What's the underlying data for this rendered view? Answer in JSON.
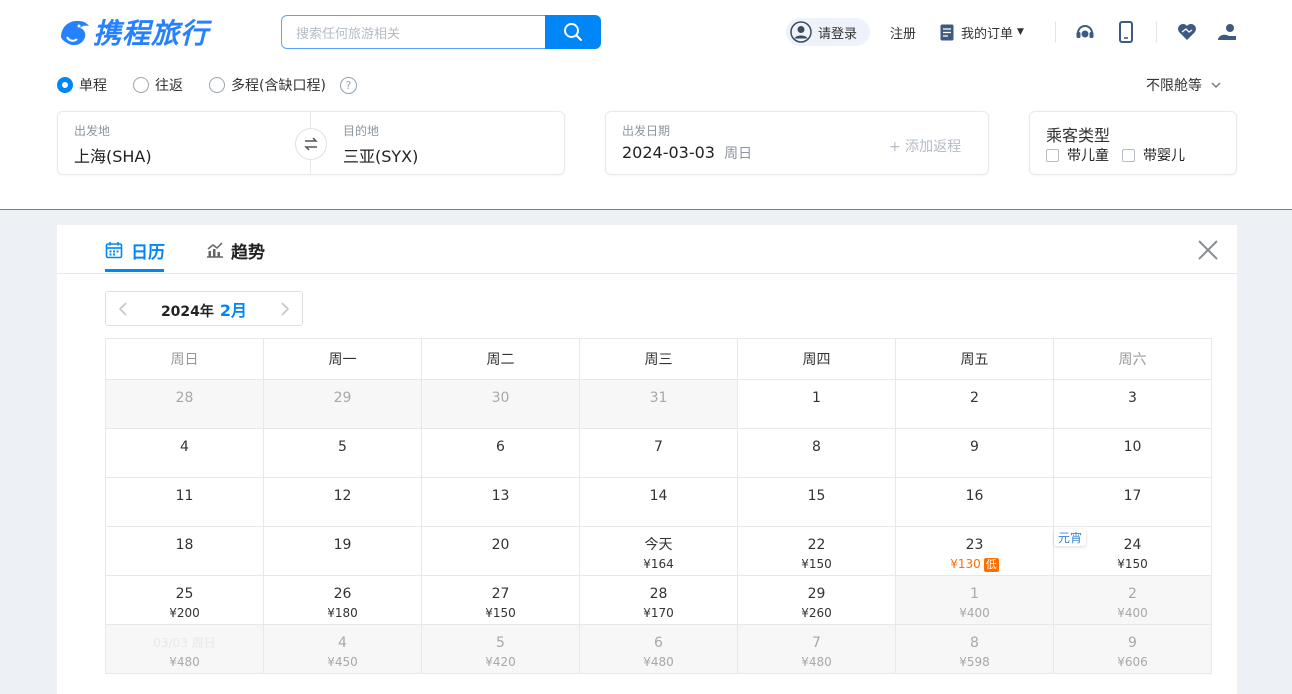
{
  "brand": {
    "name": "携程旅行",
    "color": "#0086f6"
  },
  "search": {
    "placeholder": "搜索任何旅游相关"
  },
  "header": {
    "login": "请登录",
    "register": "注册",
    "orders": "我的订单",
    "icons": [
      "customer-service-icon",
      "mobile-icon",
      "favorites-icon",
      "user-service-icon"
    ]
  },
  "trip_type": {
    "options": [
      "单程",
      "往返",
      "多程(含缺口程)"
    ],
    "selected": "单程",
    "cabin": "不限舱等"
  },
  "route": {
    "from_label": "出发地",
    "from_value": "上海(SHA)",
    "to_label": "目的地",
    "to_value": "三亚(SYX)"
  },
  "date": {
    "label": "出发日期",
    "value": "2024-03-03",
    "weekday": "周日",
    "add_return": "+ 添加返程"
  },
  "passengers": {
    "label": "乘客类型",
    "child": "带儿童",
    "infant": "带婴儿"
  },
  "calendar_panel": {
    "tabs": [
      "日历",
      "趋势"
    ],
    "year": "2024年",
    "month": "2月",
    "weekdays": [
      "周日",
      "周一",
      "周二",
      "周三",
      "周四",
      "周五",
      "周六"
    ],
    "weeks": [
      [
        {
          "n": "28",
          "dim": true
        },
        {
          "n": "29",
          "dim": true
        },
        {
          "n": "30",
          "dim": true
        },
        {
          "n": "31",
          "dim": true
        },
        {
          "n": "1"
        },
        {
          "n": "2"
        },
        {
          "n": "3"
        }
      ],
      [
        {
          "n": "4"
        },
        {
          "n": "5"
        },
        {
          "n": "6"
        },
        {
          "n": "7"
        },
        {
          "n": "8"
        },
        {
          "n": "9"
        },
        {
          "n": "10"
        }
      ],
      [
        {
          "n": "11"
        },
        {
          "n": "12"
        },
        {
          "n": "13"
        },
        {
          "n": "14"
        },
        {
          "n": "15"
        },
        {
          "n": "16"
        },
        {
          "n": "17"
        }
      ],
      [
        {
          "n": "18"
        },
        {
          "n": "19"
        },
        {
          "n": "20"
        },
        {
          "n": "今天",
          "p": "¥164"
        },
        {
          "n": "22",
          "p": "¥150"
        },
        {
          "n": "23",
          "p": "¥130",
          "low": true,
          "badge": "低"
        },
        {
          "n": "24",
          "p": "¥150",
          "holiday": "元宵"
        }
      ],
      [
        {
          "n": "25",
          "p": "¥200"
        },
        {
          "n": "26",
          "p": "¥180"
        },
        {
          "n": "27",
          "p": "¥150"
        },
        {
          "n": "28",
          "p": "¥170"
        },
        {
          "n": "29",
          "p": "¥260"
        },
        {
          "n": "1",
          "p": "¥400",
          "dim": true
        },
        {
          "n": "2",
          "p": "¥400",
          "dim": true
        }
      ],
      [
        {
          "n": "03/03 周日",
          "p": "¥480",
          "dim": true,
          "faint": true
        },
        {
          "n": "4",
          "p": "¥450",
          "dim": true
        },
        {
          "n": "5",
          "p": "¥420",
          "dim": true
        },
        {
          "n": "6",
          "p": "¥480",
          "dim": true
        },
        {
          "n": "7",
          "p": "¥480",
          "dim": true
        },
        {
          "n": "8",
          "p": "¥598",
          "dim": true
        },
        {
          "n": "9",
          "p": "¥606",
          "dim": true
        }
      ]
    ]
  }
}
